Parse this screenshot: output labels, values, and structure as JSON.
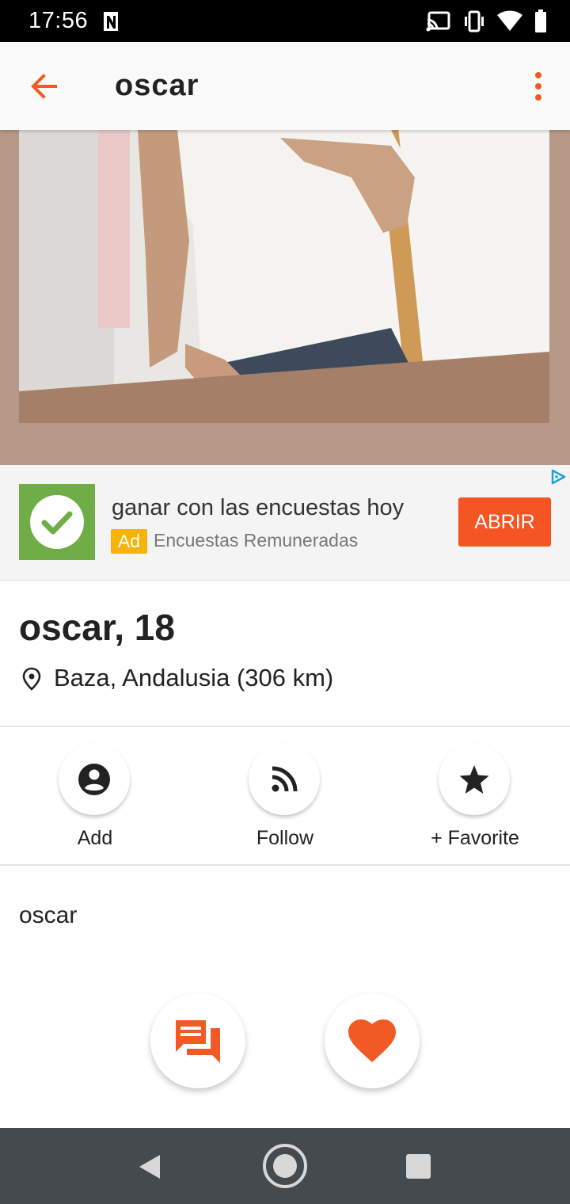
{
  "status_bar": {
    "time": "17:56",
    "icons": [
      "notification-n-icon",
      "cast-icon",
      "vibrate-icon",
      "wifi-icon",
      "battery-icon"
    ]
  },
  "app_bar": {
    "title": "oscar",
    "back_icon": "arrow-left-icon",
    "menu_icon": "more-vert-icon"
  },
  "ad": {
    "title": "ganar con las encuestas hoy",
    "badge": "Ad",
    "advertiser": "Encuestas Remuneradas",
    "cta": "ABRIR"
  },
  "profile": {
    "name_age": "oscar, 18",
    "location": "Baza, Andalusia (306 km)",
    "about": "oscar"
  },
  "actions": [
    {
      "label": "Add",
      "icon": "account-circle-icon"
    },
    {
      "label": "Follow",
      "icon": "rss-feed-icon"
    },
    {
      "label": "+ Favorite",
      "icon": "star-icon"
    }
  ],
  "fabs": [
    {
      "icon": "chat-icon"
    },
    {
      "icon": "heart-icon"
    }
  ],
  "colors": {
    "accent": "#f15a24",
    "ad_button": "#f55423",
    "ad_badge": "#f6b30a",
    "ad_logo": "#6fad46",
    "nav_bar": "#454a4f",
    "photo_frame": "#b59886"
  }
}
